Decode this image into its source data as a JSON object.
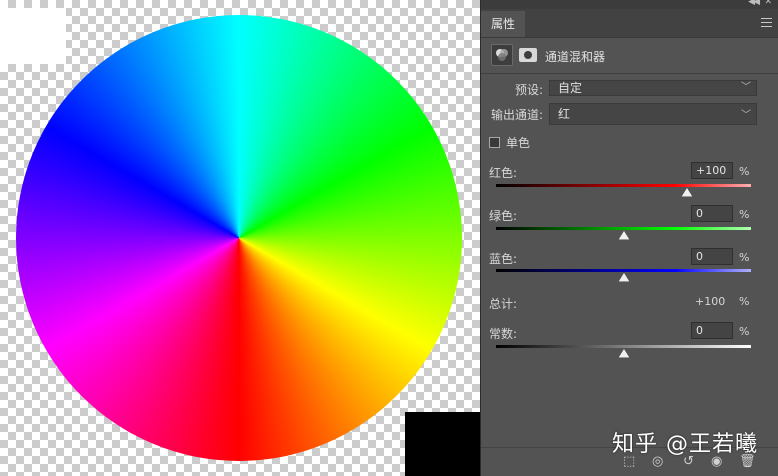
{
  "panel": {
    "tab_label": "属性",
    "title": "通道混和器",
    "preset_label": "预设:",
    "preset_value": "自定",
    "output_label": "输出通道:",
    "output_value": "红",
    "monochrome_label": "单色",
    "channels": [
      {
        "label": "红色:",
        "value": "+100",
        "unit": "%",
        "level": 100
      },
      {
        "label": "绿色:",
        "value": "0",
        "unit": "%",
        "level": 0
      },
      {
        "label": "蓝色:",
        "value": "0",
        "unit": "%",
        "level": 0
      }
    ],
    "total_label": "总计:",
    "total_value": "+100",
    "total_unit": "%",
    "constant": {
      "label": "常数:",
      "value": "0",
      "unit": "%",
      "level": 0
    }
  },
  "watermark": "知乎 @王若曦",
  "colors": {
    "red_track": "#ff0000",
    "green_track": "#00ff00",
    "blue_track": "#0000ff",
    "panel_bg": "#535353"
  },
  "icons": [
    "collapse-icon",
    "close-icon",
    "panel-menu-icon",
    "channel-mixer-icon",
    "layer-mask-icon",
    "clip-to-layer-icon",
    "view-previous-icon",
    "reset-icon",
    "visibility-eye-icon",
    "trash-icon"
  ]
}
